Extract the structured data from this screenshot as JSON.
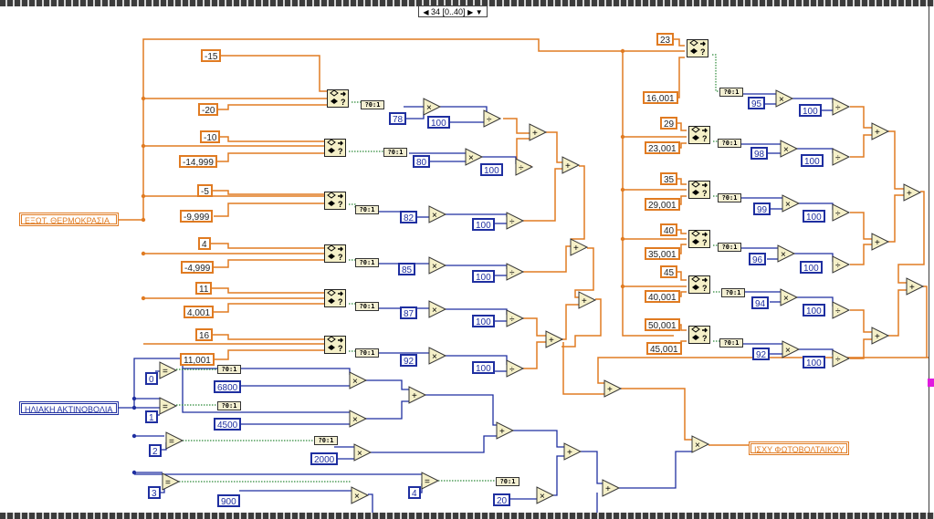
{
  "frame": {
    "selector_label": "34 [0..40]",
    "prev_icon": "left-arrow-icon",
    "next_icon": "right-arrow-icon",
    "dropdown_icon": "chevron-down-icon"
  },
  "indicators": {
    "temperature": "ΕΞΩΤ. ΘΕΡΜΟΚΡΑΣΙΑ",
    "radiation": "ΗΛΙΑΚΗ ΑΚΤΙΝΟΒΟΛΙΑ",
    "pv_power": "ΙΣΧΥ ΦΩΤΟΒΟΛΤΑΙΚΟΥ"
  },
  "converter_label": "?0:1",
  "orange_constants": [
    "-15",
    "-20",
    "-10",
    "-14,999",
    "-5",
    "-9,999",
    "4",
    "-4,999",
    "11",
    "4,001",
    "16",
    "11,001",
    "23",
    "16,001",
    "29",
    "23,001",
    "35",
    "29,001",
    "40",
    "35,001",
    "45",
    "40,001",
    "50,001",
    "45,001"
  ],
  "blue_constants": [
    "78",
    "100",
    "80",
    "100",
    "82",
    "100",
    "85",
    "100",
    "87",
    "100",
    "92",
    "100",
    "95",
    "100",
    "98",
    "100",
    "99",
    "100",
    "96",
    "100",
    "94",
    "100",
    "92",
    "100",
    "0",
    "1",
    "2",
    "3",
    "6800",
    "4500",
    "2000",
    "900",
    "4",
    "20"
  ],
  "colors": {
    "orange_wire": "#e07b22",
    "blue_wire": "#1f2fa0",
    "bool_wire": "#2e8b3a",
    "node_fill": "#f5f0c8",
    "port": "#e01adf"
  }
}
